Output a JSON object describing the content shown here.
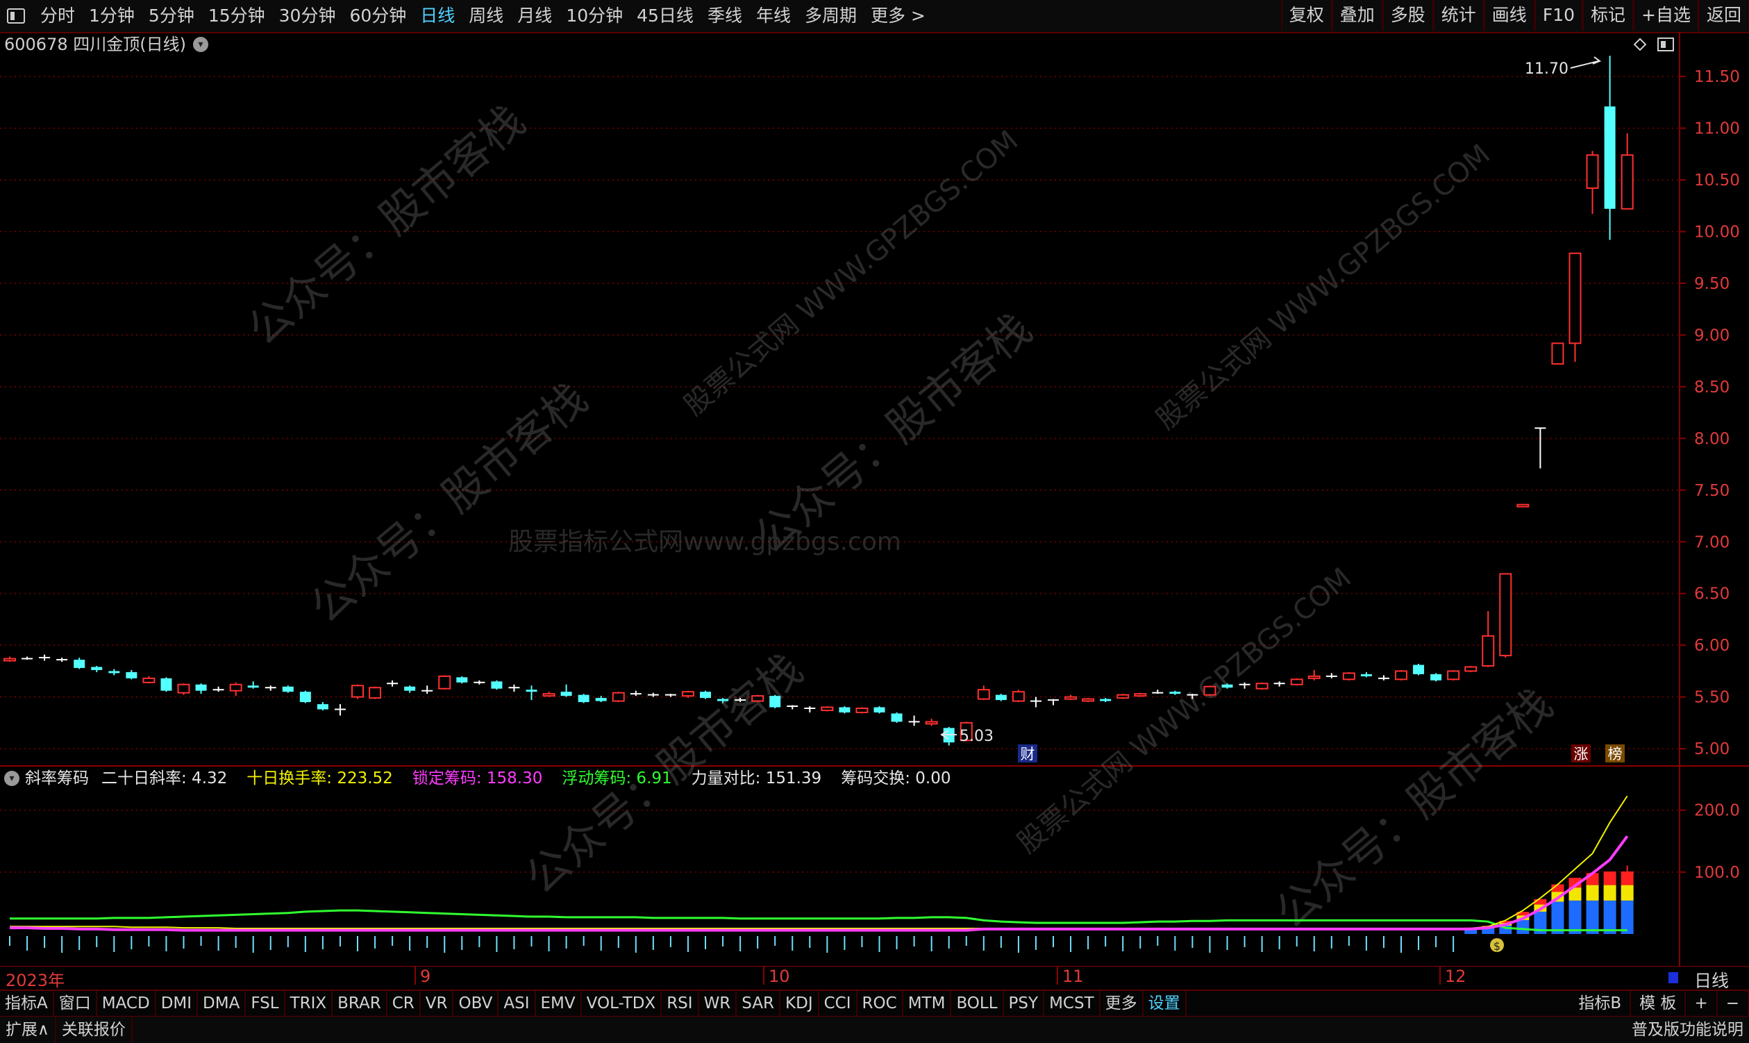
{
  "toolbar": {
    "periods": [
      "分时",
      "1分钟",
      "5分钟",
      "15分钟",
      "30分钟",
      "60分钟",
      "日线",
      "周线",
      "月线",
      "10分钟",
      "45日线",
      "季线",
      "年线",
      "多周期",
      "更多 >"
    ],
    "active": "日线",
    "right_buttons": [
      "复权",
      "叠加",
      "多股",
      "统计",
      "画线",
      "F10",
      "标记",
      "+自选",
      "返回"
    ]
  },
  "stock": {
    "title": "600678 四川金顶(日线)"
  },
  "price_axis": [
    "11.50",
    "11.00",
    "10.50",
    "10.00",
    "9.50",
    "9.00",
    "8.50",
    "8.00",
    "7.50",
    "7.00",
    "6.50",
    "6.00",
    "5.50",
    "5.00"
  ],
  "annotations": {
    "high": "11.70",
    "low": "5.03",
    "fin_tag": "财",
    "zhang_tag": "涨",
    "bang_tag": "榜"
  },
  "watermarks": {
    "center": "股票指标公式网www.gpzbgs.com",
    "account": "公众号：股市客栈",
    "site": "股票公式网 WWW.GPZBGS.COM"
  },
  "indicator": {
    "name": "斜率筹码",
    "items": [
      {
        "label": "二十日斜率:",
        "value": "4.32",
        "color": "#e6e6e6"
      },
      {
        "label": "十日换手率:",
        "value": "223.52",
        "color": "#f2f200"
      },
      {
        "label": "锁定筹码:",
        "value": "158.30",
        "color": "#ff3cff"
      },
      {
        "label": "浮动筹码:",
        "value": "6.91",
        "color": "#30ff30"
      },
      {
        "label": "力量对比:",
        "value": "151.39",
        "color": "#e6e6e6"
      },
      {
        "label": "筹码交换:",
        "value": "0.00",
        "color": "#e6e6e6"
      }
    ],
    "axis": [
      "200.0",
      "100.0"
    ]
  },
  "dates": {
    "year": "2023年",
    "months": [
      {
        "label": "9",
        "x": 605
      },
      {
        "label": "10",
        "x": 1107
      },
      {
        "label": "11",
        "x": 1530
      },
      {
        "label": "12",
        "x": 2081
      }
    ],
    "period": "日线"
  },
  "indicator_tabs": [
    "指标A",
    "窗口",
    "MACD",
    "DMI",
    "DMA",
    "FSL",
    "TRIX",
    "BRAR",
    "CR",
    "VR",
    "OBV",
    "ASI",
    "EMV",
    "VOL-TDX",
    "RSI",
    "WR",
    "SAR",
    "KDJ",
    "CCI",
    "ROC",
    "MTM",
    "BOLL",
    "PSY",
    "MCST",
    "更多",
    "设置"
  ],
  "indicator_tabs_right": [
    "指标B",
    "模 板",
    "+",
    "−"
  ],
  "status_bar": {
    "left": [
      "扩展∧",
      "关联报价"
    ],
    "right": "普及版功能说明"
  },
  "colors": {
    "up": "#ff3030",
    "down": "#54ffff",
    "grid": "#7a0000",
    "accent": "#4fd2ff"
  },
  "chart_data": {
    "type": "candlestick",
    "candles": [
      {
        "o": 5.85,
        "c": 5.87,
        "h": 5.89,
        "l": 5.84
      },
      {
        "o": 5.87,
        "c": 5.87,
        "h": 5.89,
        "l": 5.86
      },
      {
        "o": 5.88,
        "c": 5.87,
        "h": 5.91,
        "l": 5.85
      },
      {
        "o": 5.86,
        "c": 5.85,
        "h": 5.88,
        "l": 5.84
      },
      {
        "o": 5.86,
        "c": 5.78,
        "h": 5.88,
        "l": 5.77
      },
      {
        "o": 5.79,
        "c": 5.76,
        "h": 5.8,
        "l": 5.74
      },
      {
        "o": 5.75,
        "c": 5.73,
        "h": 5.77,
        "l": 5.71
      },
      {
        "o": 5.74,
        "c": 5.68,
        "h": 5.76,
        "l": 5.67
      },
      {
        "o": 5.64,
        "c": 5.68,
        "h": 5.7,
        "l": 5.63
      },
      {
        "o": 5.68,
        "c": 5.56,
        "h": 5.69,
        "l": 5.55
      },
      {
        "o": 5.54,
        "c": 5.62,
        "h": 5.63,
        "l": 5.52
      },
      {
        "o": 5.62,
        "c": 5.56,
        "h": 5.63,
        "l": 5.53
      },
      {
        "o": 5.56,
        "c": 5.57,
        "h": 5.6,
        "l": 5.55
      },
      {
        "o": 5.56,
        "c": 5.62,
        "h": 5.64,
        "l": 5.51
      },
      {
        "o": 5.61,
        "c": 5.59,
        "h": 5.65,
        "l": 5.58
      },
      {
        "o": 5.59,
        "c": 5.58,
        "h": 5.61,
        "l": 5.56
      },
      {
        "o": 5.6,
        "c": 5.55,
        "h": 5.61,
        "l": 5.54
      },
      {
        "o": 5.55,
        "c": 5.45,
        "h": 5.56,
        "l": 5.44
      },
      {
        "o": 5.43,
        "c": 5.38,
        "h": 5.45,
        "l": 5.37
      },
      {
        "o": 5.38,
        "c": 5.37,
        "h": 5.43,
        "l": 5.32
      },
      {
        "o": 5.5,
        "c": 5.61,
        "h": 5.62,
        "l": 5.48
      },
      {
        "o": 5.49,
        "c": 5.59,
        "h": 5.6,
        "l": 5.48
      },
      {
        "o": 5.62,
        "c": 5.63,
        "h": 5.66,
        "l": 5.6
      },
      {
        "o": 5.6,
        "c": 5.56,
        "h": 5.61,
        "l": 5.54
      },
      {
        "o": 5.55,
        "c": 5.56,
        "h": 5.61,
        "l": 5.53
      },
      {
        "o": 5.58,
        "c": 5.7,
        "h": 5.71,
        "l": 5.57
      },
      {
        "o": 5.69,
        "c": 5.64,
        "h": 5.7,
        "l": 5.63
      },
      {
        "o": 5.63,
        "c": 5.64,
        "h": 5.66,
        "l": 5.62
      },
      {
        "o": 5.65,
        "c": 5.58,
        "h": 5.66,
        "l": 5.57
      },
      {
        "o": 5.59,
        "c": 5.58,
        "h": 5.62,
        "l": 5.55
      },
      {
        "o": 5.57,
        "c": 5.55,
        "h": 5.61,
        "l": 5.47
      },
      {
        "o": 5.51,
        "c": 5.53,
        "h": 5.55,
        "l": 5.5
      },
      {
        "o": 5.55,
        "c": 5.51,
        "h": 5.62,
        "l": 5.5
      },
      {
        "o": 5.52,
        "c": 5.45,
        "h": 5.53,
        "l": 5.44
      },
      {
        "o": 5.49,
        "c": 5.46,
        "h": 5.51,
        "l": 5.45
      },
      {
        "o": 5.46,
        "c": 5.54,
        "h": 5.55,
        "l": 5.45
      },
      {
        "o": 5.53,
        "c": 5.52,
        "h": 5.56,
        "l": 5.51
      },
      {
        "o": 5.51,
        "c": 5.52,
        "h": 5.54,
        "l": 5.5
      },
      {
        "o": 5.51,
        "c": 5.52,
        "h": 5.53,
        "l": 5.5
      },
      {
        "o": 5.51,
        "c": 5.55,
        "h": 5.56,
        "l": 5.49
      },
      {
        "o": 5.55,
        "c": 5.49,
        "h": 5.56,
        "l": 5.48
      },
      {
        "o": 5.48,
        "c": 5.46,
        "h": 5.49,
        "l": 5.44
      },
      {
        "o": 5.47,
        "c": 5.46,
        "h": 5.49,
        "l": 5.45
      },
      {
        "o": 5.46,
        "c": 5.51,
        "h": 5.52,
        "l": 5.45
      },
      {
        "o": 5.51,
        "c": 5.4,
        "h": 5.52,
        "l": 5.39
      },
      {
        "o": 5.41,
        "c": 5.4,
        "h": 5.42,
        "l": 5.38
      },
      {
        "o": 5.39,
        "c": 5.38,
        "h": 5.41,
        "l": 5.35
      },
      {
        "o": 5.37,
        "c": 5.4,
        "h": 5.41,
        "l": 5.36
      },
      {
        "o": 5.4,
        "c": 5.35,
        "h": 5.41,
        "l": 5.34
      },
      {
        "o": 5.35,
        "c": 5.39,
        "h": 5.4,
        "l": 5.34
      },
      {
        "o": 5.4,
        "c": 5.35,
        "h": 5.41,
        "l": 5.34
      },
      {
        "o": 5.34,
        "c": 5.26,
        "h": 5.35,
        "l": 5.25
      },
      {
        "o": 5.26,
        "c": 5.25,
        "h": 5.32,
        "l": 5.22
      },
      {
        "o": 5.24,
        "c": 5.26,
        "h": 5.29,
        "l": 5.22
      },
      {
        "o": 5.2,
        "c": 5.06,
        "h": 5.21,
        "l": 5.03
      },
      {
        "o": 5.08,
        "c": 5.25,
        "h": 5.26,
        "l": 5.07
      },
      {
        "o": 5.48,
        "c": 5.57,
        "h": 5.61,
        "l": 5.47
      },
      {
        "o": 5.52,
        "c": 5.47,
        "h": 5.53,
        "l": 5.46
      },
      {
        "o": 5.46,
        "c": 5.55,
        "h": 5.57,
        "l": 5.45
      },
      {
        "o": 5.46,
        "c": 5.45,
        "h": 5.5,
        "l": 5.4
      },
      {
        "o": 5.47,
        "c": 5.46,
        "h": 5.48,
        "l": 5.42
      },
      {
        "o": 5.48,
        "c": 5.5,
        "h": 5.52,
        "l": 5.47
      },
      {
        "o": 5.46,
        "c": 5.48,
        "h": 5.49,
        "l": 5.45
      },
      {
        "o": 5.48,
        "c": 5.46,
        "h": 5.49,
        "l": 5.45
      },
      {
        "o": 5.49,
        "c": 5.52,
        "h": 5.53,
        "l": 5.48
      },
      {
        "o": 5.51,
        "c": 5.53,
        "h": 5.54,
        "l": 5.5
      },
      {
        "o": 5.54,
        "c": 5.54,
        "h": 5.57,
        "l": 5.53
      },
      {
        "o": 5.55,
        "c": 5.53,
        "h": 5.56,
        "l": 5.52
      },
      {
        "o": 5.52,
        "c": 5.52,
        "h": 5.53,
        "l": 5.48
      },
      {
        "o": 5.52,
        "c": 5.6,
        "h": 5.61,
        "l": 5.51
      },
      {
        "o": 5.62,
        "c": 5.59,
        "h": 5.63,
        "l": 5.58
      },
      {
        "o": 5.61,
        "c": 5.62,
        "h": 5.64,
        "l": 5.58
      },
      {
        "o": 5.58,
        "c": 5.63,
        "h": 5.64,
        "l": 5.57
      },
      {
        "o": 5.63,
        "c": 5.62,
        "h": 5.65,
        "l": 5.6
      },
      {
        "o": 5.62,
        "c": 5.67,
        "h": 5.68,
        "l": 5.61
      },
      {
        "o": 5.68,
        "c": 5.7,
        "h": 5.76,
        "l": 5.66
      },
      {
        "o": 5.7,
        "c": 5.7,
        "h": 5.73,
        "l": 5.68
      },
      {
        "o": 5.67,
        "c": 5.73,
        "h": 5.74,
        "l": 5.66
      },
      {
        "o": 5.72,
        "c": 5.7,
        "h": 5.74,
        "l": 5.69
      },
      {
        "o": 5.68,
        "c": 5.68,
        "h": 5.71,
        "l": 5.66
      },
      {
        "o": 5.67,
        "c": 5.75,
        "h": 5.76,
        "l": 5.66
      },
      {
        "o": 5.81,
        "c": 5.72,
        "h": 5.82,
        "l": 5.71
      },
      {
        "o": 5.72,
        "c": 5.66,
        "h": 5.73,
        "l": 5.65
      },
      {
        "o": 5.67,
        "c": 5.75,
        "h": 5.76,
        "l": 5.66
      },
      {
        "o": 5.75,
        "c": 5.79,
        "h": 5.8,
        "l": 5.74
      },
      {
        "o": 5.8,
        "c": 6.09,
        "h": 6.33,
        "l": 5.79
      },
      {
        "o": 5.9,
        "c": 6.69,
        "h": 6.69,
        "l": 5.88
      },
      {
        "o": 7.34,
        "c": 7.36,
        "h": 7.36,
        "l": 7.34
      },
      {
        "o": 8.1,
        "c": 8.1,
        "h": 8.1,
        "l": 7.71
      },
      {
        "o": 8.72,
        "c": 8.92,
        "h": 8.92,
        "l": 8.72
      },
      {
        "o": 8.92,
        "c": 9.79,
        "h": 9.79,
        "l": 8.74
      },
      {
        "o": 10.42,
        "c": 10.74,
        "h": 10.78,
        "l": 10.17
      },
      {
        "o": 11.21,
        "c": 10.22,
        "h": 11.7,
        "l": 9.92
      },
      {
        "o": 10.22,
        "c": 10.74,
        "h": 10.95,
        "l": 10.22
      }
    ],
    "slots": [
      0,
      1,
      2,
      3,
      4,
      5,
      6,
      7,
      8,
      9,
      10,
      11,
      12,
      13,
      14,
      15,
      16,
      17,
      18,
      19,
      20,
      21,
      22,
      23,
      24,
      25,
      26,
      27,
      28,
      29,
      30,
      31,
      32,
      33,
      34,
      35,
      36,
      37,
      38,
      39,
      40,
      41,
      42,
      43,
      44,
      45,
      46,
      47,
      48,
      49,
      50,
      51,
      52,
      53,
      54,
      55,
      56,
      57,
      58,
      59,
      60,
      61,
      62,
      63,
      64,
      65,
      66,
      67,
      68,
      69,
      70,
      71,
      72,
      73,
      74,
      75,
      76,
      77,
      78,
      79,
      80,
      81,
      82,
      83,
      84,
      85,
      86,
      87,
      88,
      89,
      90,
      91,
      92,
      93
    ],
    "y_range": [
      4.92,
      11.85
    ],
    "indicator": {
      "y_range": [
        0,
        230
      ],
      "green": [
        25,
        25,
        25,
        25,
        25,
        25,
        26,
        26,
        26,
        27,
        28,
        29,
        30,
        31,
        32,
        33,
        34,
        36,
        37,
        38,
        38,
        37,
        36,
        35,
        34,
        33,
        32,
        31,
        30,
        29,
        28,
        28,
        27,
        27,
        27,
        27,
        27,
        26,
        26,
        26,
        26,
        26,
        25,
        25,
        25,
        25,
        25,
        25,
        25,
        25,
        25,
        26,
        26,
        27,
        27,
        26,
        22,
        20,
        19,
        18,
        18,
        18,
        18,
        18,
        18,
        19,
        20,
        20,
        21,
        21,
        22,
        22,
        22,
        22,
        22,
        22,
        22,
        22,
        22,
        22,
        22,
        22,
        22,
        22,
        22,
        20,
        10,
        8,
        6,
        6,
        6,
        6,
        6,
        6
      ],
      "magenta": [
        10,
        10,
        9,
        9,
        8,
        8,
        7,
        7,
        7,
        7,
        6,
        6,
        6,
        6,
        6,
        6,
        6,
        6,
        6,
        6,
        6,
        6,
        6,
        6,
        6,
        6,
        6,
        6,
        6,
        6,
        6,
        6,
        6,
        6,
        6,
        6,
        6,
        6,
        6,
        6,
        6,
        6,
        6,
        6,
        6,
        6,
        6,
        6,
        6,
        6,
        6,
        6,
        6,
        6,
        6,
        6,
        8,
        8,
        8,
        8,
        8,
        8,
        8,
        8,
        8,
        8,
        8,
        8,
        8,
        8,
        8,
        8,
        8,
        8,
        8,
        8,
        8,
        8,
        8,
        8,
        8,
        8,
        8,
        8,
        8,
        10,
        15,
        25,
        40,
        58,
        78,
        98,
        120,
        158
      ],
      "yellow": [
        12,
        12,
        12,
        12,
        12,
        12,
        12,
        11,
        11,
        11,
        10,
        10,
        10,
        9,
        9,
        9,
        9,
        9,
        9,
        9,
        9,
        9,
        9,
        9,
        9,
        9,
        9,
        9,
        9,
        9,
        9,
        9,
        9,
        9,
        9,
        9,
        9,
        9,
        9,
        9,
        9,
        9,
        9,
        9,
        9,
        9,
        9,
        9,
        9,
        9,
        9,
        9,
        9,
        9,
        9,
        9,
        9,
        9,
        9,
        9,
        9,
        9,
        9,
        9,
        9,
        9,
        9,
        9,
        9,
        9,
        9,
        9,
        9,
        9,
        9,
        9,
        9,
        9,
        9,
        9,
        9,
        9,
        9,
        9,
        9,
        12,
        22,
        38,
        58,
        80,
        105,
        130,
        180,
        223
      ]
    }
  }
}
